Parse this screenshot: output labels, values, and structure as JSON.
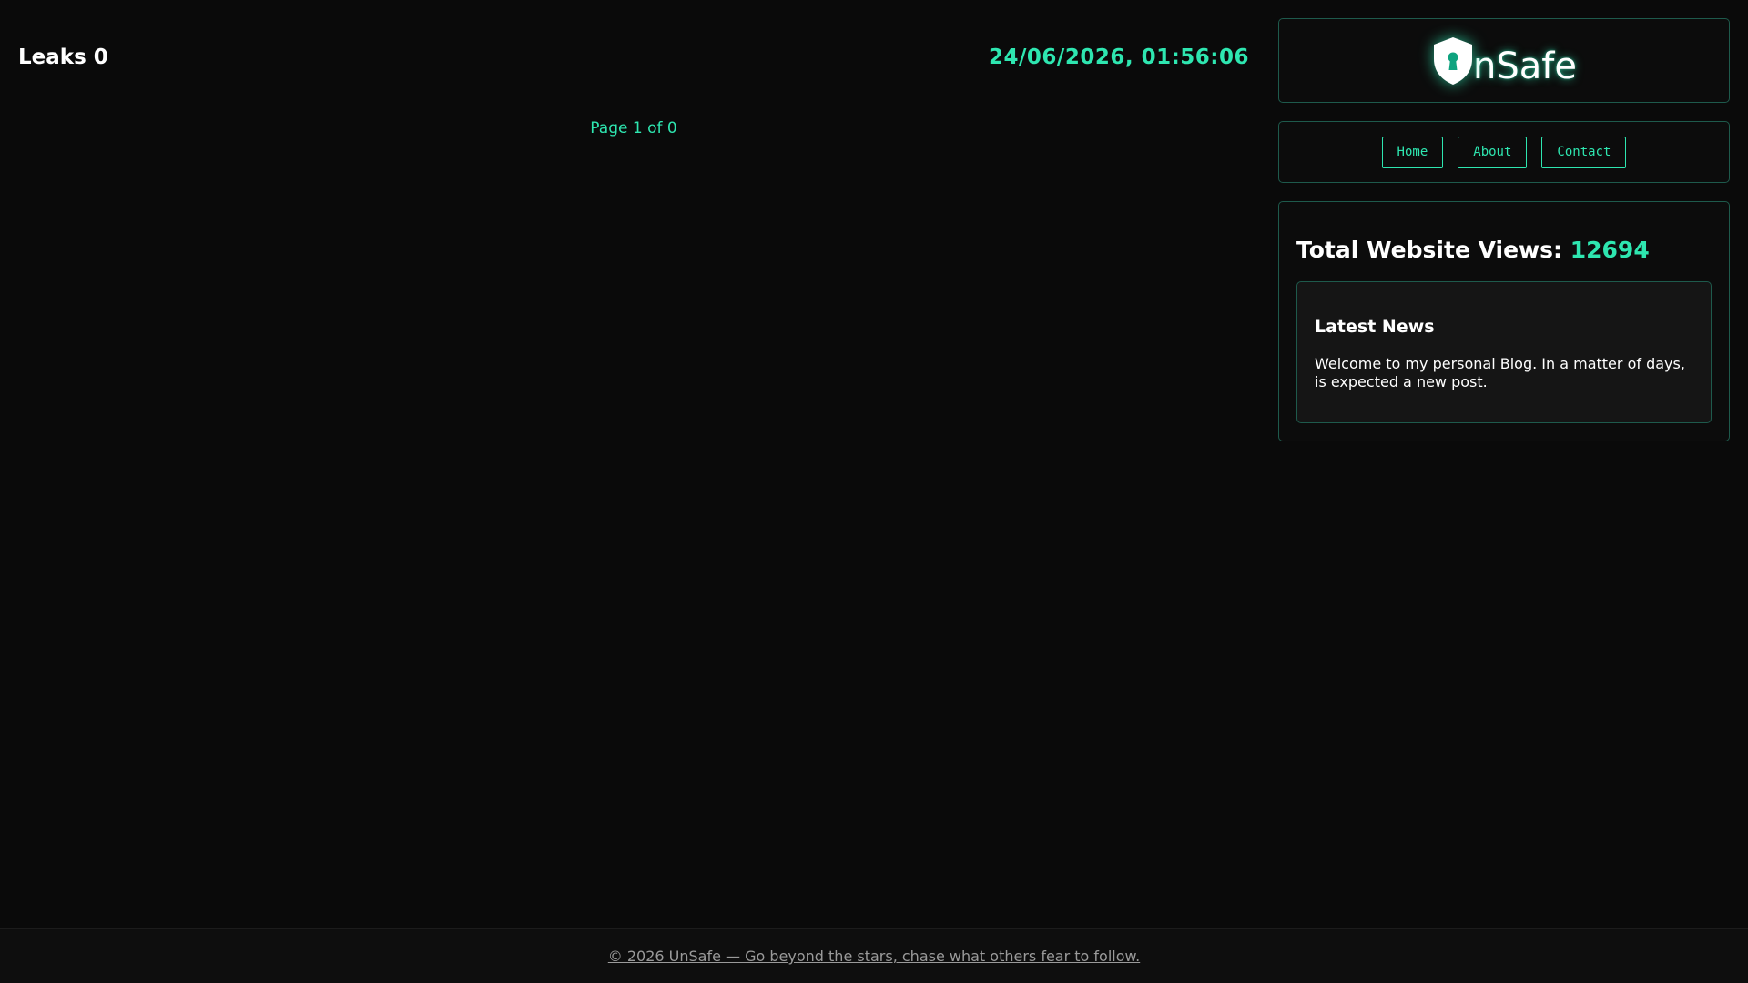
{
  "main": {
    "title": "Leaks 0",
    "datetime": "24/06/2026, 01:56:06",
    "pagination": "Page 1 of 0"
  },
  "sidebar": {
    "logo": {
      "text": "nSafe",
      "icon": "shield-keyhole-icon"
    },
    "nav": {
      "home_label": "Home",
      "about_label": "About",
      "contact_label": "Contact"
    },
    "stats": {
      "views_label": "Total Website Views:",
      "views_count": "12694"
    },
    "news": {
      "title": "Latest News",
      "body": "Welcome to my personal Blog. In a matter of days, is expected a new post."
    }
  },
  "footer": {
    "text": "© 2026 UnSafe — Go beyond the stars, chase what others fear to follow."
  },
  "colors": {
    "accent": "#2ee6b0",
    "background": "#0a0a0a",
    "border": "#1e5a4c"
  }
}
